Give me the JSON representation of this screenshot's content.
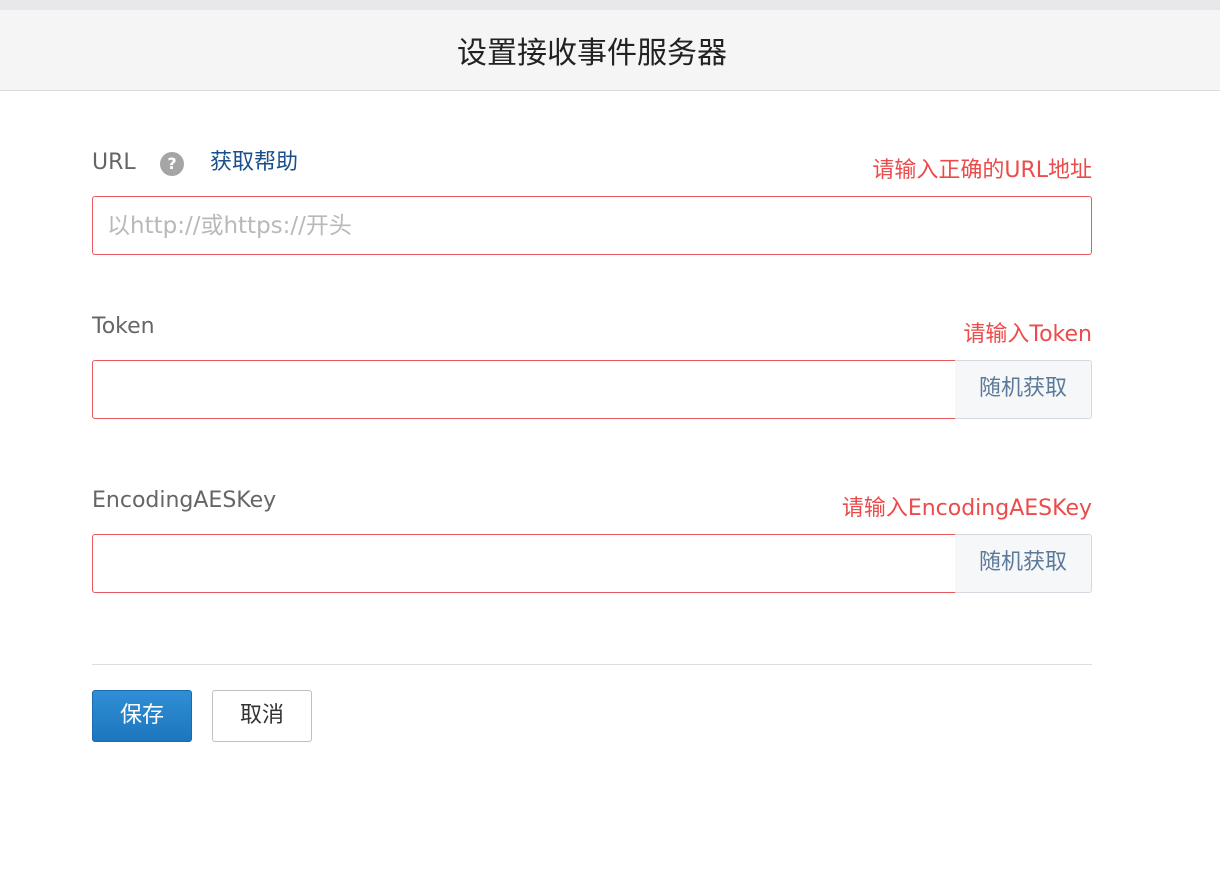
{
  "header": {
    "title": "设置接收事件服务器"
  },
  "url_field": {
    "label": "URL",
    "help_icon_glyph": "?",
    "help_link": "获取帮助",
    "error": "请输入正确的URL地址",
    "placeholder": "以http://或https://开头",
    "value": ""
  },
  "token_field": {
    "label": "Token",
    "error": "请输入Token",
    "value": "",
    "random_button": "随机获取"
  },
  "aes_field": {
    "label": "EncodingAESKey",
    "error": "请输入EncodingAESKey",
    "value": "",
    "random_button": "随机获取"
  },
  "actions": {
    "save": "保存",
    "cancel": "取消"
  },
  "colors": {
    "error": "#ec4b4b",
    "primary": "#1d76bd",
    "link": "#1a4f8a"
  },
  "icons": {
    "help": "question-circle-icon"
  }
}
